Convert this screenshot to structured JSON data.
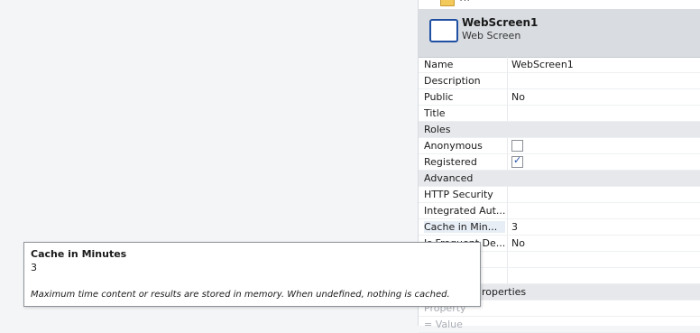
{
  "tree": {
    "node_label": "Th"
  },
  "header": {
    "title": "WebScreen1",
    "subtitle": "Web Screen"
  },
  "properties": {
    "name": {
      "label": "Name",
      "value": "WebScreen1"
    },
    "description": {
      "label": "Description",
      "value": ""
    },
    "public": {
      "label": "Public",
      "value": "No"
    },
    "title": {
      "label": "Title",
      "value": ""
    },
    "roles_section": {
      "label": "Roles"
    },
    "anonymous": {
      "label": "Anonymous",
      "checked": false
    },
    "registered": {
      "label": "Registered",
      "checked": true
    },
    "advanced_section": {
      "label": "Advanced"
    },
    "http_security": {
      "label": "HTTP Security",
      "value": ""
    },
    "integrated_auth": {
      "label": "Integrated Aut...",
      "value": ""
    },
    "cache_minutes": {
      "label": "Cache in Min...",
      "value": "3"
    },
    "is_frequent": {
      "label": "Is Frequent De...",
      "value": "No"
    },
    "extended_section": {
      "label": "roperties"
    },
    "extended_property": {
      "label": "Property"
    },
    "extended_value": {
      "label": "= Value"
    }
  },
  "tooltip": {
    "title": "Cache in Minutes",
    "value": "3",
    "description": "Maximum time content or results are stored in memory. When undefined, nothing is cached."
  }
}
